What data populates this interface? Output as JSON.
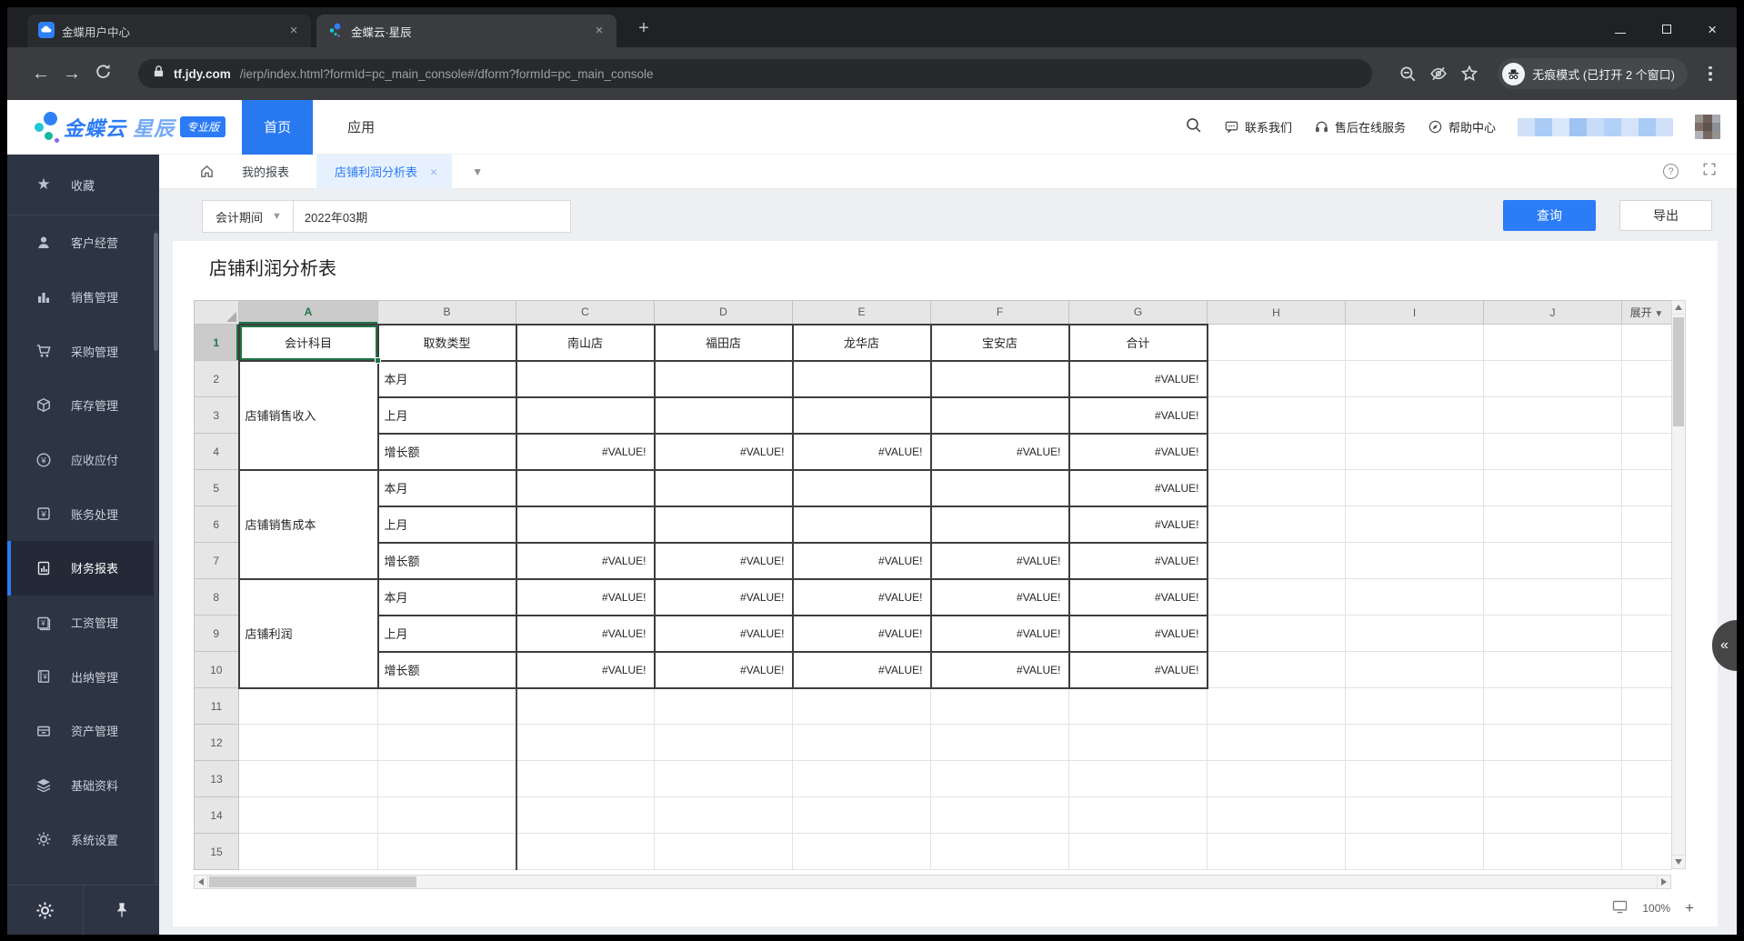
{
  "browser": {
    "tabs": [
      {
        "title": "金蝶用户中心"
      },
      {
        "title": "金蝶云·星辰"
      }
    ],
    "url": {
      "host": "tf.jdy.com",
      "path": "/ierp/index.html?formId=pc_main_console#/dform?formId=pc_main_console"
    },
    "incognito_label": "无痕模式  (已打开 2 个窗口)"
  },
  "header": {
    "brand_primary": "金蝶云",
    "brand_secondary": "星辰",
    "brand_badge": "专业版",
    "nav": [
      {
        "label": "首页"
      },
      {
        "label": "应用"
      }
    ],
    "links": [
      {
        "label": "联系我们"
      },
      {
        "label": "售后在线服务"
      },
      {
        "label": "帮助中心"
      }
    ]
  },
  "sidebar": {
    "items": [
      {
        "label": "收藏"
      },
      {
        "label": "客户经营"
      },
      {
        "label": "销售管理"
      },
      {
        "label": "采购管理"
      },
      {
        "label": "库存管理"
      },
      {
        "label": "应收应付"
      },
      {
        "label": "账务处理"
      },
      {
        "label": "财务报表",
        "active": true
      },
      {
        "label": "工资管理"
      },
      {
        "label": "出纳管理"
      },
      {
        "label": "资产管理"
      },
      {
        "label": "基础资料"
      },
      {
        "label": "系统设置"
      }
    ]
  },
  "workspace": {
    "doc_tabs": [
      {
        "label": "我的报表"
      },
      {
        "label": "店铺利润分析表",
        "active": true
      }
    ]
  },
  "filter": {
    "field": "会计期间",
    "value": "2022年03期"
  },
  "actions": {
    "query": "查询",
    "export": "导出"
  },
  "report": {
    "title": "店铺利润分析表"
  },
  "sheet": {
    "columns": [
      "A",
      "B",
      "C",
      "D",
      "E",
      "F",
      "G",
      "H",
      "I",
      "J"
    ],
    "expand_label": "展开",
    "row_count": 15,
    "header_row": [
      "会计科目",
      "取数类型",
      "南山店",
      "福田店",
      "龙华店",
      "宝安店",
      "合计"
    ],
    "merged_groups": [
      {
        "label": "店铺销售收入",
        "rows": [
          2,
          3,
          4
        ]
      },
      {
        "label": "店铺销售成本",
        "rows": [
          5,
          6,
          7
        ]
      },
      {
        "label": "店铺利润",
        "rows": [
          8,
          9,
          10
        ]
      }
    ],
    "data_rows": [
      {
        "n": 2,
        "type": "本月",
        "values": [
          "",
          "",
          "",
          "",
          "#VALUE!"
        ]
      },
      {
        "n": 3,
        "type": "上月",
        "values": [
          "",
          "",
          "",
          "",
          "#VALUE!"
        ]
      },
      {
        "n": 4,
        "type": "增长额",
        "values": [
          "#VALUE!",
          "#VALUE!",
          "#VALUE!",
          "#VALUE!",
          "#VALUE!"
        ]
      },
      {
        "n": 5,
        "type": "本月",
        "values": [
          "",
          "",
          "",
          "",
          "#VALUE!"
        ]
      },
      {
        "n": 6,
        "type": "上月",
        "values": [
          "",
          "",
          "",
          "",
          "#VALUE!"
        ]
      },
      {
        "n": 7,
        "type": "增长额",
        "values": [
          "#VALUE!",
          "#VALUE!",
          "#VALUE!",
          "#VALUE!",
          "#VALUE!"
        ]
      },
      {
        "n": 8,
        "type": "本月",
        "values": [
          "#VALUE!",
          "#VALUE!",
          "#VALUE!",
          "#VALUE!",
          "#VALUE!"
        ]
      },
      {
        "n": 9,
        "type": "上月",
        "values": [
          "#VALUE!",
          "#VALUE!",
          "#VALUE!",
          "#VALUE!",
          "#VALUE!"
        ]
      },
      {
        "n": 10,
        "type": "增长额",
        "values": [
          "#VALUE!",
          "#VALUE!",
          "#VALUE!",
          "#VALUE!",
          "#VALUE!"
        ]
      }
    ]
  },
  "statusbar": {
    "zoom": "100%",
    "zoom_in": "+"
  },
  "colors": {
    "accent_blue": "#2b7cf6",
    "selection_green": "#217346",
    "sidebar_bg": "#2d3443",
    "chrome_dark": "#202124"
  }
}
